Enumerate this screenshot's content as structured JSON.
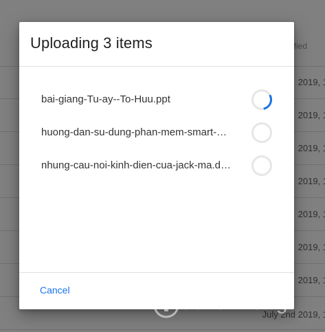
{
  "background": {
    "header_label": "fied",
    "rows": [
      {
        "text": "2019, 1"
      },
      {
        "text": "2019, 1"
      },
      {
        "text": "2019, 1"
      },
      {
        "text": "2019, 1"
      },
      {
        "text": "2019, 1"
      },
      {
        "text": "2019, 1"
      },
      {
        "text": "2019, 1"
      },
      {
        "text": "July 2nd 2019, 1"
      }
    ]
  },
  "dialog": {
    "title": "Uploading 3 items",
    "items": [
      {
        "name": "bai-giang-Tu-ay--To-Huu.ppt",
        "progress": 0.3
      },
      {
        "name": "huong-dan-su-dung-phan-mem-smart-board.pdf",
        "progress": 0
      },
      {
        "name": "nhung-cau-noi-kinh-dien-cua-jack-ma.docx",
        "progress": 0
      }
    ],
    "cancel_label": "Cancel"
  },
  "watermark": {
    "text": "uantrimang"
  },
  "colors": {
    "accent": "#1a73e8",
    "spinner_track": "#e6e6e6",
    "spinner_active": "#1a73e8"
  }
}
